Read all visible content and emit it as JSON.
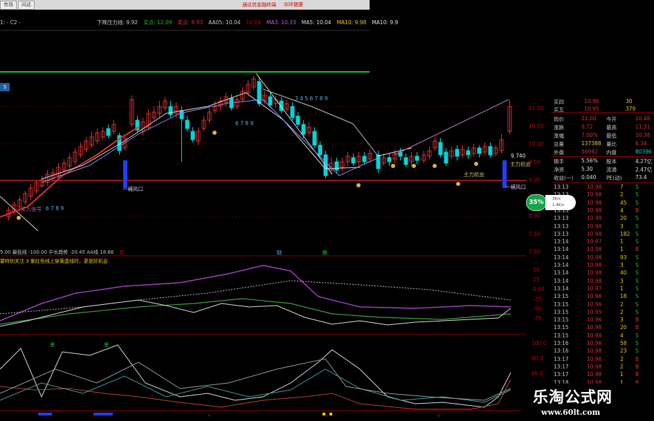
{
  "tabs": [
    "市场",
    "问达"
  ],
  "top_notes": [
    "通达信金融终端",
    "中环健康"
  ],
  "header": {
    "period": "1: - C2 -",
    "ma_items": [
      {
        "text": "下降压力线: 9.92",
        "color": "#cfcfcf"
      },
      {
        "text": "买点: 12.09",
        "color": "#21c021"
      },
      {
        "text": "卖点: 9.93",
        "color": "#e03030"
      },
      {
        "text": "AA05: 10.04",
        "color": "#c8c8c8"
      },
      {
        "text": "10.04",
        "color": "#d00000"
      },
      {
        "text": "MA3: 10.33",
        "color": "#c060e0"
      },
      {
        "text": "MA5: 10.04",
        "color": "#e0e0e0"
      },
      {
        "text": "MA10: 9.98",
        "color": "#e8d000"
      },
      {
        "text": "MA10: 9.9",
        "color": "#e0e0e0"
      }
    ]
  },
  "chart_labels": {
    "left_badge": "5",
    "gap_label_1": "一補风口",
    "gap_label_2": "一補风口",
    "buy_signal": "买入信号",
    "wave_nums_1": "6 7 8 9",
    "wave_nums_2": "3 4 5 6 7 8 9",
    "wave_nums_3": "6 7 8 9",
    "right_value": "9.740",
    "right_label": "主力机会",
    "low_label": "主力机会"
  },
  "price_axis": [
    "11.00",
    "10.50",
    "10.00",
    "9.50",
    "9.00",
    "8.50",
    "8.00",
    "7.50",
    "7.00"
  ],
  "osc1": {
    "header": "5.00  最低线 -100.00  中长趋势 -20.45  AA线 18.66",
    "note": "要特别关注  3 紫红色线上穿黄虚线时，更是好机会",
    "flags": [
      "卖",
      "财",
      "跌"
    ],
    "axis": [
      "50",
      "25",
      "0.00",
      "-25",
      "-50",
      "-75"
    ]
  },
  "osc2": {
    "axis": [
      "100.0",
      "80.0",
      "60.0"
    ],
    "tags": [
      "金",
      "金"
    ]
  },
  "time_axis": [
    "3",
    "4",
    "5",
    "6"
  ],
  "quote": {
    "bid_ask": [
      {
        "label": "买四",
        "price": "10.96",
        "vol": "30"
      },
      {
        "label": "买五",
        "price": "10.95",
        "vol": "379"
      }
    ],
    "stats": [
      {
        "l1": "现价",
        "v1": "11.00",
        "l2": "今开",
        "v2": "10.48"
      },
      {
        "l1": "涨跌",
        "v1": "0.72",
        "l2": "最高",
        "v2": "11.31"
      },
      {
        "l1": "涨幅",
        "v1": "7.00%",
        "l2": "最低",
        "v2": "10.38"
      },
      {
        "l1": "总量",
        "v1": "137388",
        "l2": "量比",
        "v2": "6.34"
      },
      {
        "l1": "外盘",
        "v1": "56992",
        "l2": "内盘",
        "v2": "80396"
      }
    ],
    "stats2": [
      {
        "l1": "换手",
        "v1": "5.56%",
        "l2": "股本",
        "v2": "4.27亿"
      },
      {
        "l1": "净资",
        "v1": "5.30",
        "l2": "流通",
        "v2": "2.47亿"
      },
      {
        "l1": "收益(一)",
        "v1": "0.040",
        "l2": "PE(动)",
        "v2": "73.4"
      }
    ],
    "circle": "35%",
    "net_up": "3K/s",
    "net_down": "1.4K/s",
    "trades": [
      {
        "t": "13:13",
        "p": "10.98",
        "v": "7",
        "d": "S"
      },
      {
        "t": "13:13",
        "p": "10.98",
        "v": "2",
        "d": "S"
      },
      {
        "t": "13:13",
        "p": "10.98",
        "v": "45",
        "d": "S"
      },
      {
        "t": "13:13",
        "p": "10.98",
        "v": "4",
        "d": "B"
      },
      {
        "t": "13:13",
        "p": "10.99",
        "v": "20",
        "d": "S"
      },
      {
        "t": "13:13",
        "p": "10.98",
        "v": "3",
        "d": "S"
      },
      {
        "t": "13:13",
        "p": "10.98",
        "v": "182",
        "d": "S"
      },
      {
        "t": "13:14",
        "p": "10.97",
        "v": "1",
        "d": "S"
      },
      {
        "t": "13:14",
        "p": "10.98",
        "v": "1",
        "d": "B"
      },
      {
        "t": "13:14",
        "p": "10.98",
        "v": "93",
        "d": "S"
      },
      {
        "t": "13:14",
        "p": "10.98",
        "v": "3",
        "d": "S"
      },
      {
        "t": "13:14",
        "p": "10.98",
        "v": "40",
        "d": "S"
      },
      {
        "t": "13:14",
        "p": "10.98",
        "v": "3",
        "d": "S"
      },
      {
        "t": "13:14",
        "p": "10.97",
        "v": "1",
        "d": "S"
      },
      {
        "t": "13:15",
        "p": "10.96",
        "v": "18",
        "d": "S"
      },
      {
        "t": "13:15",
        "p": "10.96",
        "v": "2",
        "d": "S"
      },
      {
        "t": "13:15",
        "p": "10.95",
        "v": "2",
        "d": "S"
      },
      {
        "t": "13:15",
        "p": "10.96",
        "v": "3",
        "d": "B"
      },
      {
        "t": "13:15",
        "p": "10.98",
        "v": "20",
        "d": "B"
      },
      {
        "t": "13:15",
        "p": "10.98",
        "v": "4",
        "d": "S"
      },
      {
        "t": "13:16",
        "p": "10.96",
        "v": "58",
        "d": "S"
      },
      {
        "t": "13:16",
        "p": "10.98",
        "v": "23",
        "d": "S"
      },
      {
        "t": "13:17",
        "p": "10.96",
        "v": "2",
        "d": "B"
      },
      {
        "t": "13:17",
        "p": "10.98",
        "v": "2",
        "d": "B"
      },
      {
        "t": "13:17",
        "p": "10.98",
        "v": "1",
        "d": "B"
      },
      {
        "t": "13:18",
        "p": "10.98",
        "v": "1",
        "d": "B"
      }
    ]
  },
  "watermark": {
    "title": "乐淘公式网",
    "url": "www.60lt.com"
  },
  "colors": {
    "up": "#e03030",
    "down": "#00d8d8",
    "ma5": "#e0e0e0",
    "ma10": "#e8d000",
    "accent": "#21c021"
  }
}
